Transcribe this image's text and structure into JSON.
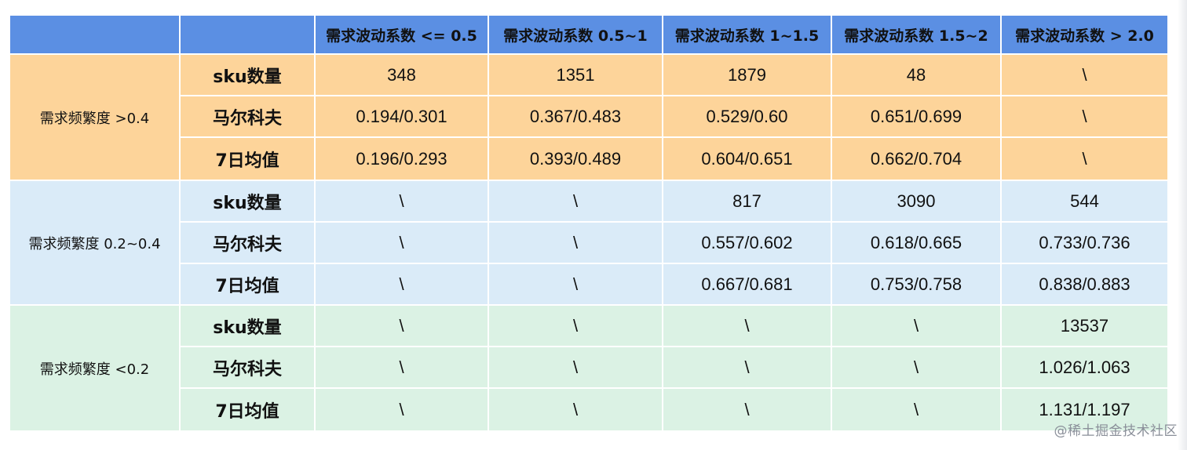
{
  "table": {
    "corner_label": "",
    "columns": [
      "",
      "需求波动系数 <= 0.5",
      "需求波动系数 0.5~1",
      "需求波动系数 1~1.5",
      "需求波动系数 1.5~2",
      "需求波动系数 > 2.0"
    ],
    "groups": [
      {
        "label": "需求频繁度 >0.4",
        "rows": [
          {
            "metric": "sku数量",
            "values": [
              "348",
              "1351",
              "1879",
              "48",
              "\\"
            ]
          },
          {
            "metric": "马尔科夫",
            "values": [
              "0.194/0.301",
              "0.367/0.483",
              "0.529/0.60",
              "0.651/0.699",
              "\\"
            ]
          },
          {
            "metric": "7日均值",
            "values": [
              "0.196/0.293",
              "0.393/0.489",
              "0.604/0.651",
              "0.662/0.704",
              "\\"
            ]
          }
        ]
      },
      {
        "label": "需求频繁度 0.2~0.4",
        "rows": [
          {
            "metric": "sku数量",
            "values": [
              "\\",
              "\\",
              "817",
              "3090",
              "544"
            ]
          },
          {
            "metric": "马尔科夫",
            "values": [
              "\\",
              "\\",
              "0.557/0.602",
              "0.618/0.665",
              "0.733/0.736"
            ]
          },
          {
            "metric": "7日均值",
            "values": [
              "\\",
              "\\",
              "0.667/0.681",
              "0.753/0.758",
              "0.838/0.883"
            ]
          }
        ]
      },
      {
        "label": "需求频繁度 <0.2",
        "rows": [
          {
            "metric": "sku数量",
            "values": [
              "\\",
              "\\",
              "\\",
              "\\",
              "13537"
            ]
          },
          {
            "metric": "马尔科夫",
            "values": [
              "\\",
              "\\",
              "\\",
              "\\",
              "1.026/1.063"
            ]
          },
          {
            "metric": "7日均值",
            "values": [
              "\\",
              "\\",
              "\\",
              "\\",
              "1.131/1.197"
            ]
          }
        ]
      }
    ]
  },
  "watermark": "@稀土掘金技术社区",
  "colors": {
    "header": "#5b8fe3",
    "group_1": "#fdd49a",
    "group_2": "#daebf8",
    "group_3": "#dbf2e4"
  }
}
